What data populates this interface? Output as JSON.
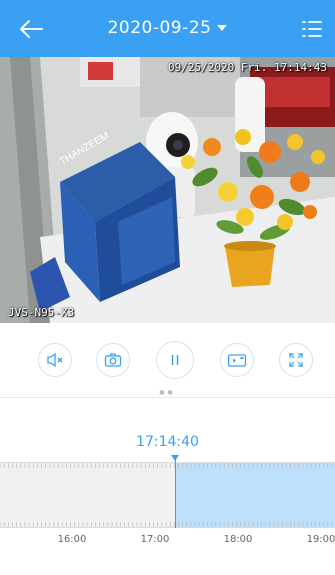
{
  "header": {
    "date": "2020-09-25"
  },
  "video": {
    "osd_timestamp": "09/25/2020 Fri. 17:14:43",
    "camera_name": "JVS-N95-X3",
    "box_brand": "THANZEEM"
  },
  "controls": {
    "mute": "mute-icon",
    "snapshot": "camera-icon",
    "pause": "pause-icon",
    "record": "video-record-icon",
    "fullscreen": "fullscreen-icon"
  },
  "timeline": {
    "current_time": "17:14:40",
    "hours": [
      "16:00",
      "17:00",
      "18:00",
      "19:00"
    ]
  },
  "colors": {
    "accent": "#3aa0f3",
    "recorded": "#bfe0fb"
  }
}
